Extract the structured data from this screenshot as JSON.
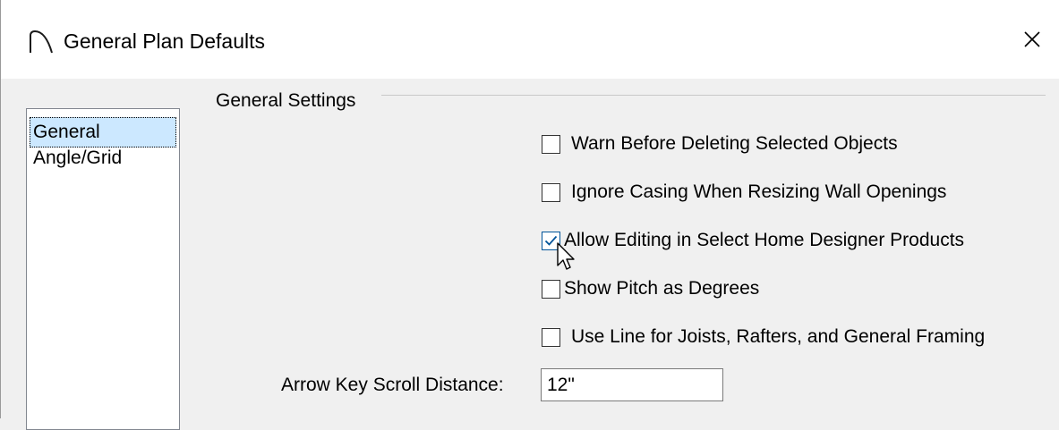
{
  "window": {
    "title": "General Plan Defaults",
    "app_icon": "roof-arc-icon",
    "close_icon": "close-icon"
  },
  "nav": {
    "items": [
      {
        "label": "General",
        "selected": true
      },
      {
        "label": "Angle/Grid",
        "selected": false
      }
    ]
  },
  "general_settings": {
    "group_label": "General Settings",
    "checkboxes": [
      {
        "label": "Warn Before Deleting Selected Objects",
        "checked": false
      },
      {
        "label": "Ignore Casing When Resizing Wall Openings",
        "checked": false
      },
      {
        "label": "Allow Editing in Select Home Designer Products",
        "checked": true
      },
      {
        "label": "Show Pitch as Degrees",
        "checked": false
      },
      {
        "label": "Use Line for Joists, Rafters, and General Framing",
        "checked": false
      }
    ],
    "scroll_distance": {
      "label": "Arrow Key Scroll Distance:",
      "value": "12\""
    }
  },
  "colors": {
    "selection": "#cce8ff",
    "check_accent": "#005499"
  }
}
